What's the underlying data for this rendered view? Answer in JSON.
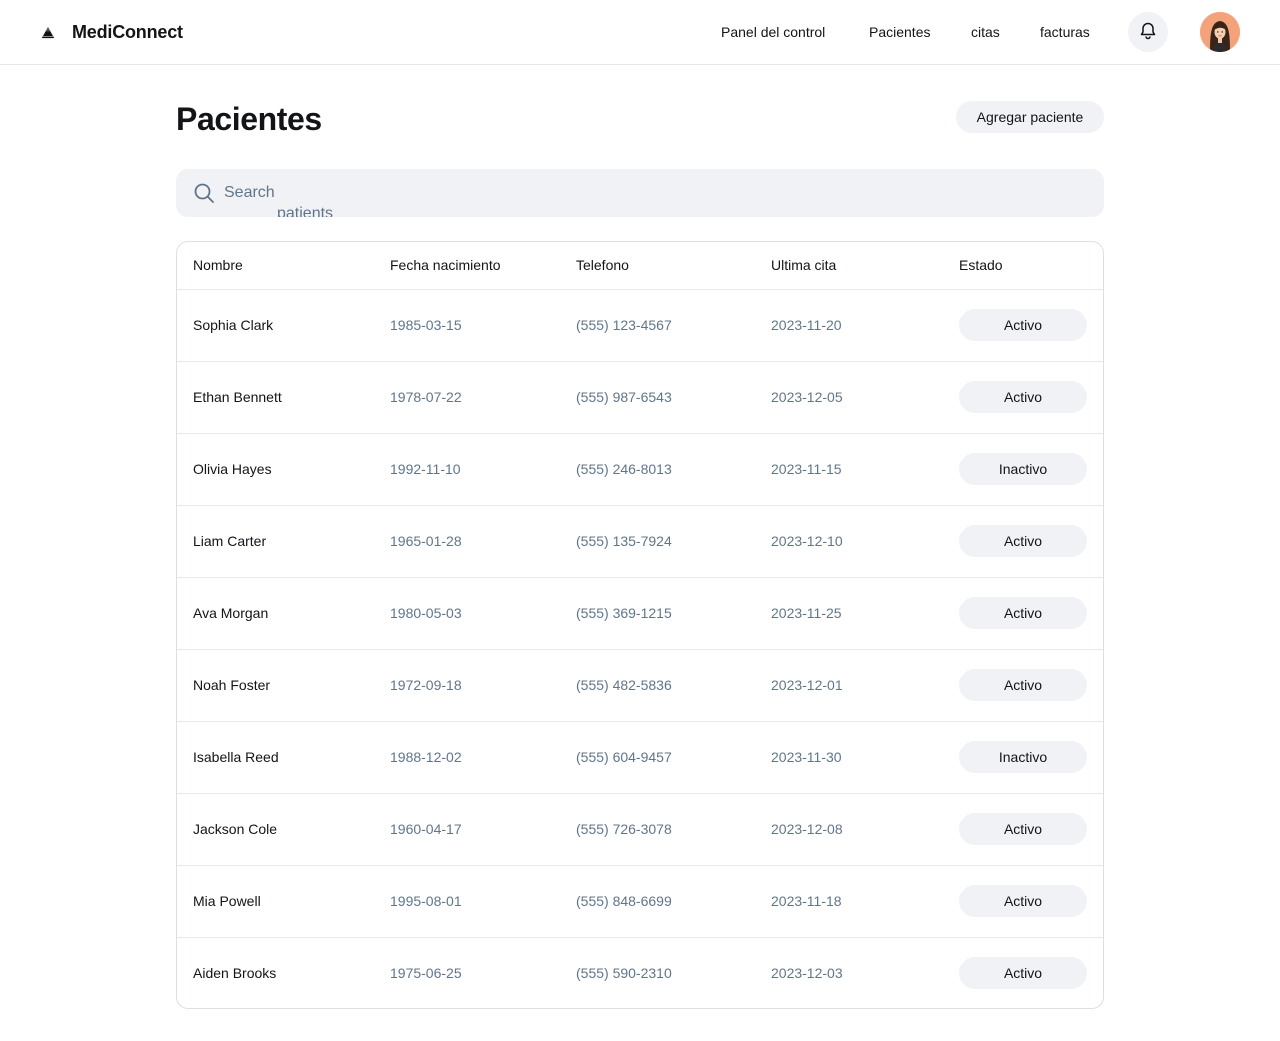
{
  "app": {
    "name": "MediConnect"
  },
  "nav": {
    "items": [
      {
        "label": "Panel del control"
      },
      {
        "label": "Pacientes"
      },
      {
        "label": "citas"
      },
      {
        "label": "facturas"
      }
    ]
  },
  "header": {
    "bell_icon": "bell-icon",
    "avatar_icon": "user-avatar"
  },
  "page": {
    "title": "Pacientes",
    "add_button": "Agregar paciente"
  },
  "search": {
    "placeholder": "Search",
    "overflow_text": "patients",
    "icon": "search-icon"
  },
  "table": {
    "columns": [
      "Nombre",
      "Fecha nacimiento",
      "Telefono",
      "Ultima cita",
      "Estado"
    ],
    "rows": [
      {
        "name": "Sophia Clark",
        "dob": "1985-03-15",
        "phone": "(555) 123-4567",
        "last": "2023-11-20",
        "status": "Activo"
      },
      {
        "name": "Ethan Bennett",
        "dob": "1978-07-22",
        "phone": "(555) 987-6543",
        "last": "2023-12-05",
        "status": "Activo"
      },
      {
        "name": "Olivia Hayes",
        "dob": "1992-11-10",
        "phone": "(555) 246-8013",
        "last": "2023-11-15",
        "status": "Inactivo"
      },
      {
        "name": "Liam Carter",
        "dob": "1965-01-28",
        "phone": "(555) 135-7924",
        "last": "2023-12-10",
        "status": "Activo"
      },
      {
        "name": "Ava Morgan",
        "dob": "1980-05-03",
        "phone": "(555) 369-1215",
        "last": "2023-11-25",
        "status": "Activo"
      },
      {
        "name": "Noah Foster",
        "dob": "1972-09-18",
        "phone": "(555) 482-5836",
        "last": "2023-12-01",
        "status": "Activo"
      },
      {
        "name": "Isabella Reed",
        "dob": "1988-12-02",
        "phone": "(555) 604-9457",
        "last": "2023-11-30",
        "status": "Inactivo"
      },
      {
        "name": "Jackson Cole",
        "dob": "1960-04-17",
        "phone": "(555) 726-3078",
        "last": "2023-12-08",
        "status": "Activo"
      },
      {
        "name": "Mia Powell",
        "dob": "1995-08-01",
        "phone": "(555) 848-6699",
        "last": "2023-11-18",
        "status": "Activo"
      },
      {
        "name": "Aiden Brooks",
        "dob": "1975-06-25",
        "phone": "(555) 590-2310",
        "last": "2023-12-03",
        "status": "Activo"
      }
    ]
  }
}
